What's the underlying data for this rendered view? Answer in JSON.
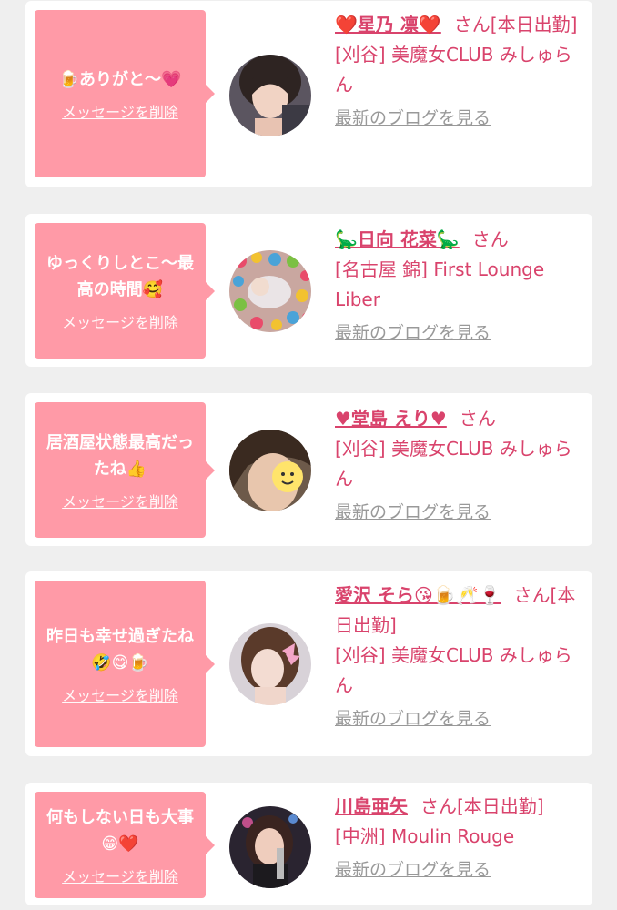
{
  "items": [
    {
      "message": "🍺ありがと〜💗",
      "delete_label": "メッセージを削除",
      "name": "❤️星乃 凛❤️",
      "honorific": "さん",
      "status": "[本日出勤]",
      "shop": "[刈谷] 美魔女CLUB みしゅらん",
      "blog_label": "最新のブログを見る"
    },
    {
      "message": "ゆっくりしとこ〜最高の時間🥰",
      "delete_label": "メッセージを削除",
      "name": "🦕日向 花菜🦕",
      "honorific": "さん",
      "status": "",
      "shop": "[名古屋 錦] First Lounge Liber",
      "blog_label": "最新のブログを見る"
    },
    {
      "message": "居酒屋状態最高だったね👍",
      "delete_label": "メッセージを削除",
      "name": "♥堂島 えり♥",
      "honorific": "さん",
      "status": "",
      "shop": "[刈谷] 美魔女CLUB みしゅらん",
      "blog_label": "最新のブログを見る"
    },
    {
      "message": "昨日も幸せ過ぎたね🤣😋🍺",
      "delete_label": "メッセージを削除",
      "name": "愛沢 そら😘🍺🥂🍷",
      "honorific": "さん",
      "status": "[本日出勤]",
      "shop": "[刈谷] 美魔女CLUB みしゅらん",
      "blog_label": "最新のブログを見る"
    },
    {
      "message": "何もしない日も大事😁❤️",
      "delete_label": "メッセージを削除",
      "name": "川島亜矢",
      "honorific": "さん",
      "status": "[本日出勤]",
      "shop": "[中洲] Moulin Rouge",
      "blog_label": "最新のブログを見る"
    }
  ]
}
